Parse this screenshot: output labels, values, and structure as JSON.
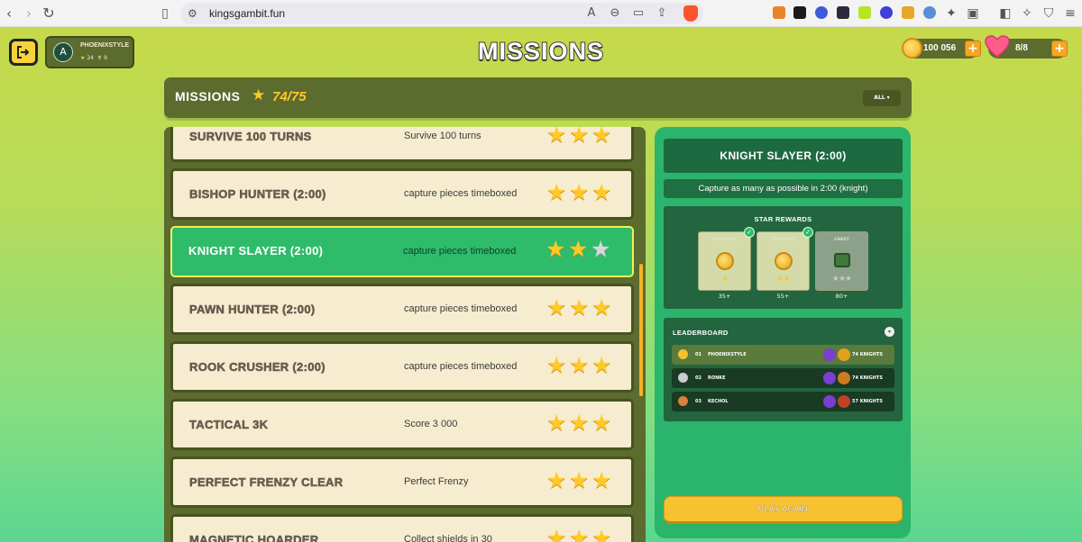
{
  "browser": {
    "url": "kingsgambit.fun"
  },
  "player": {
    "avatar_letter": "A",
    "name": "PHOENIXSTYLE",
    "stars": "24",
    "trophies": "9"
  },
  "page_title": "MISSIONS",
  "currency": {
    "coins": "100 056",
    "lives": "8/8",
    "plus": "+"
  },
  "missions_header": {
    "title": "MISSIONS",
    "progress": "74/75",
    "filter": "ALL ▾"
  },
  "missions": [
    {
      "name": "SURVIVE 100 TURNS",
      "desc": "Survive 100 turns",
      "stars": 3
    },
    {
      "name": "BISHOP HUNTER (2:00)",
      "desc": "capture pieces timeboxed",
      "stars": 3
    },
    {
      "name": "KNIGHT SLAYER (2:00)",
      "desc": "capture pieces timeboxed",
      "stars": 2,
      "active": true
    },
    {
      "name": "PAWN HUNTER (2:00)",
      "desc": "capture pieces timeboxed",
      "stars": 3
    },
    {
      "name": "ROOK CRUSHER (2:00)",
      "desc": "capture pieces timeboxed",
      "stars": 3
    },
    {
      "name": "TACTICAL 3K",
      "desc": "Score 3 000",
      "stars": 3
    },
    {
      "name": "PERFECT FRENZY CLEAR",
      "desc": "Perfect Frenzy",
      "stars": 3
    },
    {
      "name": "MAGNETIC HOARDER",
      "desc": "Collect shields in 30",
      "stars": 3
    }
  ],
  "detail": {
    "title": "KNIGHT SLAYER (2:00)",
    "description": "Capture as many as possible in 2:00 (knight)",
    "star_rewards": {
      "title": "STAR REWARDS",
      "tiers": [
        {
          "label": "100 COINS",
          "threshold": "35+",
          "claimed": true,
          "kind": "coin",
          "stars": "★"
        },
        {
          "label": "200 COINS",
          "threshold": "55+",
          "claimed": true,
          "kind": "coin",
          "stars": "★★"
        },
        {
          "label": "CHEST",
          "threshold": "80+",
          "claimed": false,
          "kind": "chest",
          "stars": "★★★"
        }
      ]
    },
    "leaderboard": {
      "title": "LEADERBOARD",
      "rows": [
        {
          "rank": "01",
          "name": "PHOENIXSTYLE",
          "score": "74 KNIGHTS",
          "medal": "#f2c12e",
          "me": true
        },
        {
          "rank": "02",
          "name": "RONKE",
          "score": "74 KNIGHTS",
          "medal": "#c9cdd2",
          "me": false
        },
        {
          "rank": "03",
          "name": "KECHOL",
          "score": "57 KNIGHTS",
          "medal": "#d8813a",
          "me": false
        }
      ]
    },
    "play_button": "PLAY AGAIN"
  }
}
